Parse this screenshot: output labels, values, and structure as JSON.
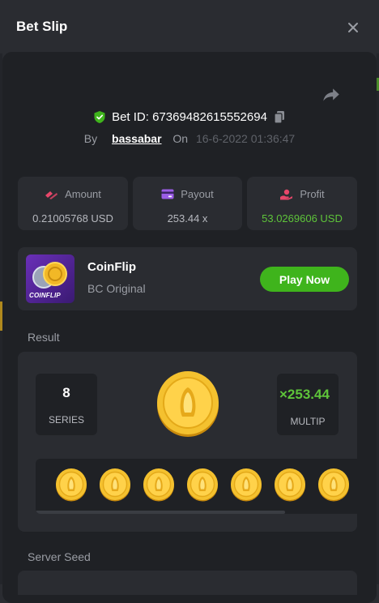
{
  "header": {
    "title": "Bet Slip"
  },
  "bet": {
    "id_label": "Bet ID: 67369482615552694",
    "by_label": "By",
    "user": "bassabar",
    "on_label": "On",
    "date": "16-6-2022 01:36:47"
  },
  "stats": [
    {
      "label": "Amount",
      "value": "0.21005768 USD",
      "icon": "amount-icon"
    },
    {
      "label": "Payout",
      "value": "253.44 x",
      "icon": "payout-card-icon"
    },
    {
      "label": "Profit",
      "value": "53.0269606 USD",
      "icon": "profit-hand-icon"
    }
  ],
  "game": {
    "name": "CoinFlip",
    "provider": "BC Original",
    "thumb_text": "COINFLIP",
    "play_label": "Play Now"
  },
  "result": {
    "label": "Result",
    "series_value": "8",
    "series_label": "SERIES",
    "multiplier_value": "×253.44",
    "multiplier_label": "MULTIP",
    "coin_count": 7
  },
  "server_seed": {
    "label": "Server Seed"
  },
  "colors": {
    "accent_green": "#3fb41c",
    "profit_green": "#5ec43a",
    "amount_pink": "#e8476a",
    "payout_purple": "#9b5de5",
    "profit_red": "#e8476a",
    "coin_gold": "#f4c12f"
  }
}
